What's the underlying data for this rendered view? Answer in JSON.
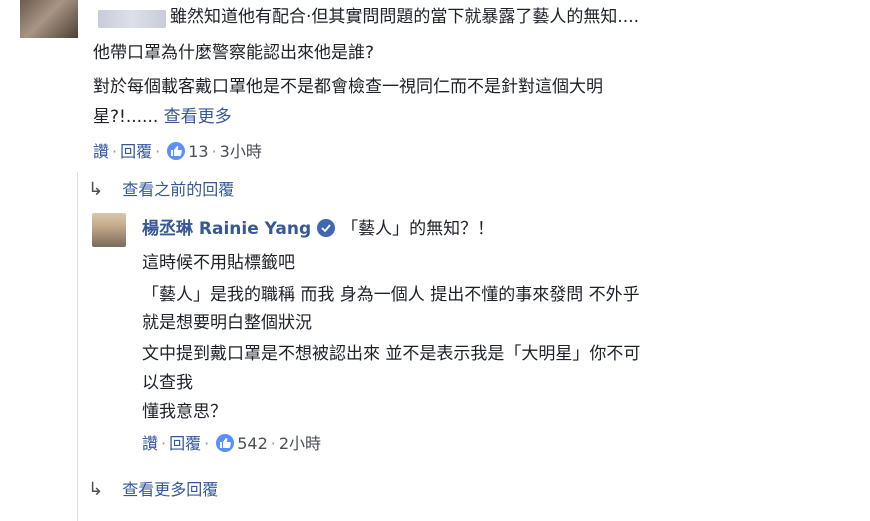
{
  "comment": {
    "line1": "雖然知道他有配合‧但其實問問題的當下就暴露了藝人的無知....",
    "line2": "他帶口罩為什麼警察能認出來他是誰?",
    "line3": "對於每個載客戴口罩他是不是都會檢查一視同仁而不是針對這個大明",
    "line4_text": "星?!......",
    "see_more": "查看更多",
    "like_label": "讚",
    "reply_label": "回覆",
    "like_count": "13",
    "time": "3小時"
  },
  "view_previous_replies": "查看之前的回覆",
  "reply": {
    "author": "楊丞琳 Rainie Yang",
    "first_line": "「藝人」的無知？！",
    "lines": [
      "這時候不用貼標籤吧",
      "「藝人」是我的職稱 而我 身為一個人 提出不懂的事來發問 不外乎",
      "就是想要明白整個狀況",
      "文中提到戴口罩是不想被認出來 並不是表示我是「大明星」你不可",
      "以查我",
      "懂我意思？"
    ],
    "like_label": "讚",
    "reply_label": "回覆",
    "like_count": "542",
    "time": "2小時"
  },
  "view_more_replies": "查看更多回覆",
  "colors": {
    "link": "#365899",
    "like_badge": "#5890ff",
    "verified": "#4267b2"
  },
  "icons": [
    "reply-arrow-icon",
    "like-icon",
    "verified-icon"
  ]
}
